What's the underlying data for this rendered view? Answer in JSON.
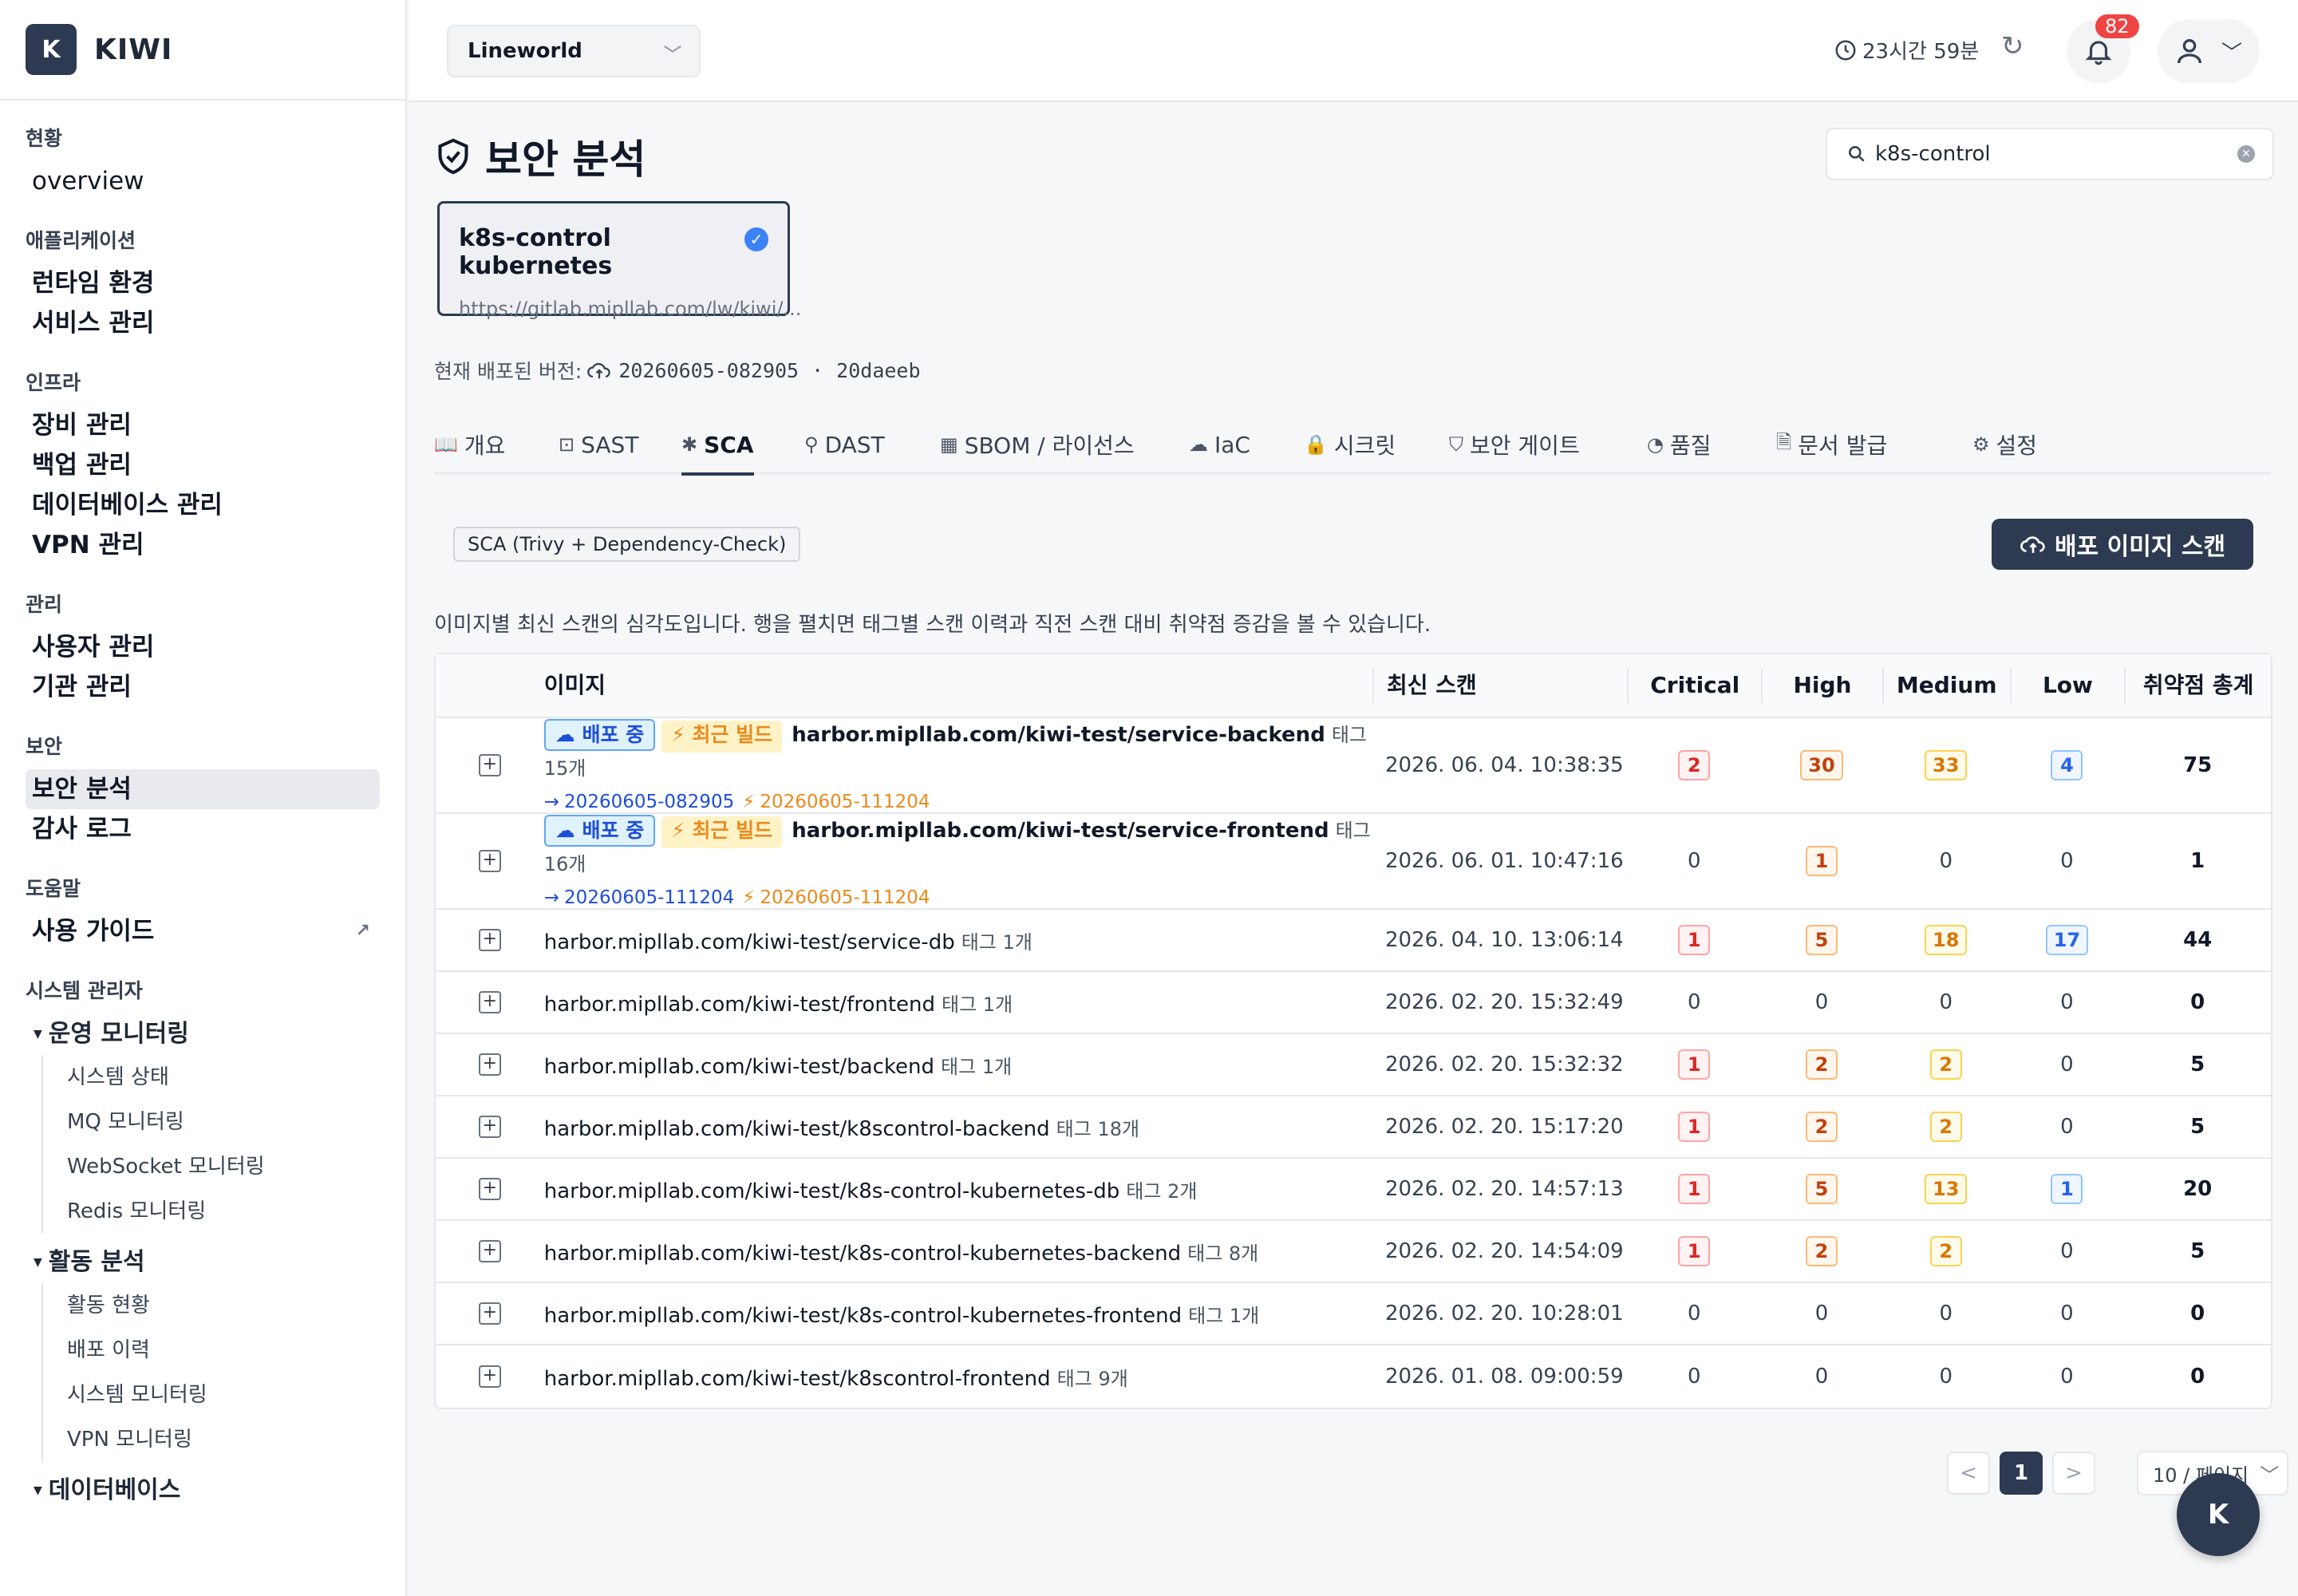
{
  "app": {
    "logo_letter": "K",
    "name": "KIWI"
  },
  "sidebar": {
    "sections": [
      {
        "title": "현황",
        "items": [
          {
            "label": "overview"
          }
        ]
      },
      {
        "title": "애플리케이션",
        "items": [
          {
            "label": "런타임 환경"
          },
          {
            "label": "서비스 관리"
          }
        ]
      },
      {
        "title": "인프라",
        "items": [
          {
            "label": "장비 관리"
          },
          {
            "label": "백업 관리"
          },
          {
            "label": "데이터베이스 관리"
          },
          {
            "label": "VPN 관리"
          }
        ]
      },
      {
        "title": "관리",
        "items": [
          {
            "label": "사용자 관리"
          },
          {
            "label": "기관 관리"
          }
        ]
      },
      {
        "title": "보안",
        "items": [
          {
            "label": "보안 분석"
          },
          {
            "label": "감사 로그"
          }
        ]
      },
      {
        "title": "도움말",
        "items": [
          {
            "label": "사용 가이드"
          }
        ]
      }
    ],
    "admin_title": "시스템 관리자",
    "groups": [
      {
        "label": "운영 모니터링",
        "items": [
          "시스템 상태",
          "MQ 모니터링",
          "WebSocket 모니터링",
          "Redis 모니터링"
        ]
      },
      {
        "label": "활동 분석",
        "items": [
          "활동 현황",
          "배포 이력",
          "시스템 모니터링",
          "VPN 모니터링"
        ]
      },
      {
        "label": "데이터베이스",
        "items": []
      }
    ]
  },
  "topbar": {
    "project": "Lineworld",
    "timer": "23시간 59분",
    "notifications": "82"
  },
  "page": {
    "title": "보안 분석",
    "search_value": "k8s-control",
    "repo": {
      "name": "k8s-control kubernetes",
      "url": "https://gitlab.mipllab.com/lw/kiwi/..."
    },
    "version_label": "현재 배포된 버전:",
    "version": "20260605-082905",
    "version_sep": "·",
    "commit": "20daeeb",
    "tabs": [
      {
        "label": "개요",
        "icon": "book-icon"
      },
      {
        "label": "SAST",
        "icon": "code-icon"
      },
      {
        "label": "SCA",
        "icon": "bug-icon"
      },
      {
        "label": "DAST",
        "icon": "link-icon"
      },
      {
        "label": "SBOM / 라이선스",
        "icon": "grid-icon"
      },
      {
        "label": "IaC",
        "icon": "cloud-icon"
      },
      {
        "label": "시크릿",
        "icon": "lock-icon"
      },
      {
        "label": "보안 게이트",
        "icon": "shield-icon"
      },
      {
        "label": "품질",
        "icon": "gauge-icon"
      },
      {
        "label": "문서 발급",
        "icon": "document-icon"
      },
      {
        "label": "설정",
        "icon": "gear-icon"
      }
    ],
    "tool_tag": "SCA (Trivy + Dependency-Check)",
    "scan_button": "배포 이미지 스캔",
    "description": "이미지별 최신 스캔의 심각도입니다. 행을 펼치면 태그별 스캔 이력과 직전 스캔 대비 취약점 증감을 볼 수 있습니다."
  },
  "table": {
    "headers": {
      "image": "이미지",
      "scan": "최신 스캔",
      "critical": "Critical",
      "high": "High",
      "medium": "Medium",
      "low": "Low",
      "total": "취약점 총계"
    },
    "rows": [
      {
        "deploy": "배포 중",
        "build": "최근 빌드",
        "image": "harbor.mipllab.com/kiwi-test/service-backend",
        "tags": "태그 15개",
        "arrow": "→",
        "deploy_version": "20260605-082905",
        "build_version": "20260605-111204",
        "scan": "2026. 06. 04. 10:38:35",
        "critical": "2",
        "high": "30",
        "medium": "33",
        "low": "4",
        "total": "75"
      },
      {
        "deploy": "배포 중",
        "build": "최근 빌드",
        "image": "harbor.mipllab.com/kiwi-test/service-frontend",
        "tags": "태그 16개",
        "arrow": "→",
        "deploy_version": "20260605-111204",
        "build_version": "20260605-111204",
        "scan": "2026. 06. 01. 10:47:16",
        "critical": "0",
        "high": "1",
        "medium": "0",
        "low": "0",
        "total": "1"
      },
      {
        "image": "harbor.mipllab.com/kiwi-test/service-db",
        "tags": "태그 1개",
        "scan": "2026. 04. 10. 13:06:14",
        "critical": "1",
        "high": "5",
        "medium": "18",
        "low": "17",
        "total": "44"
      },
      {
        "image": "harbor.mipllab.com/kiwi-test/frontend",
        "tags": "태그 1개",
        "scan": "2026. 02. 20. 15:32:49",
        "critical": "0",
        "high": "0",
        "medium": "0",
        "low": "0",
        "total": "0"
      },
      {
        "image": "harbor.mipllab.com/kiwi-test/backend",
        "tags": "태그 1개",
        "scan": "2026. 02. 20. 15:32:32",
        "critical": "1",
        "high": "2",
        "medium": "2",
        "low": "0",
        "total": "5"
      },
      {
        "image": "harbor.mipllab.com/kiwi-test/k8scontrol-backend",
        "tags": "태그 18개",
        "scan": "2026. 02. 20. 15:17:20",
        "critical": "1",
        "high": "2",
        "medium": "2",
        "low": "0",
        "total": "5"
      },
      {
        "image": "harbor.mipllab.com/kiwi-test/k8s-control-kubernetes-db",
        "tags": "태그 2개",
        "scan": "2026. 02. 20. 14:57:13",
        "critical": "1",
        "high": "5",
        "medium": "13",
        "low": "1",
        "total": "20"
      },
      {
        "image": "harbor.mipllab.com/kiwi-test/k8s-control-kubernetes-backend",
        "tags": "태그 8개",
        "scan": "2026. 02. 20. 14:54:09",
        "critical": "1",
        "high": "2",
        "medium": "2",
        "low": "0",
        "total": "5"
      },
      {
        "image": "harbor.mipllab.com/kiwi-test/k8s-control-kubernetes-frontend",
        "tags": "태그 1개",
        "scan": "2026. 02. 20. 10:28:01",
        "critical": "0",
        "high": "0",
        "medium": "0",
        "low": "0",
        "total": "0"
      },
      {
        "image": "harbor.mipllab.com/kiwi-test/k8scontrol-frontend",
        "tags": "태그 9개",
        "scan": "2026. 01. 08. 09:00:59",
        "critical": "0",
        "high": "0",
        "medium": "0",
        "low": "0",
        "total": "0"
      }
    ]
  },
  "pagination": {
    "prev": "<",
    "current": "1",
    "next": ">",
    "per_page": "10 / 페이지"
  },
  "fab": "K"
}
